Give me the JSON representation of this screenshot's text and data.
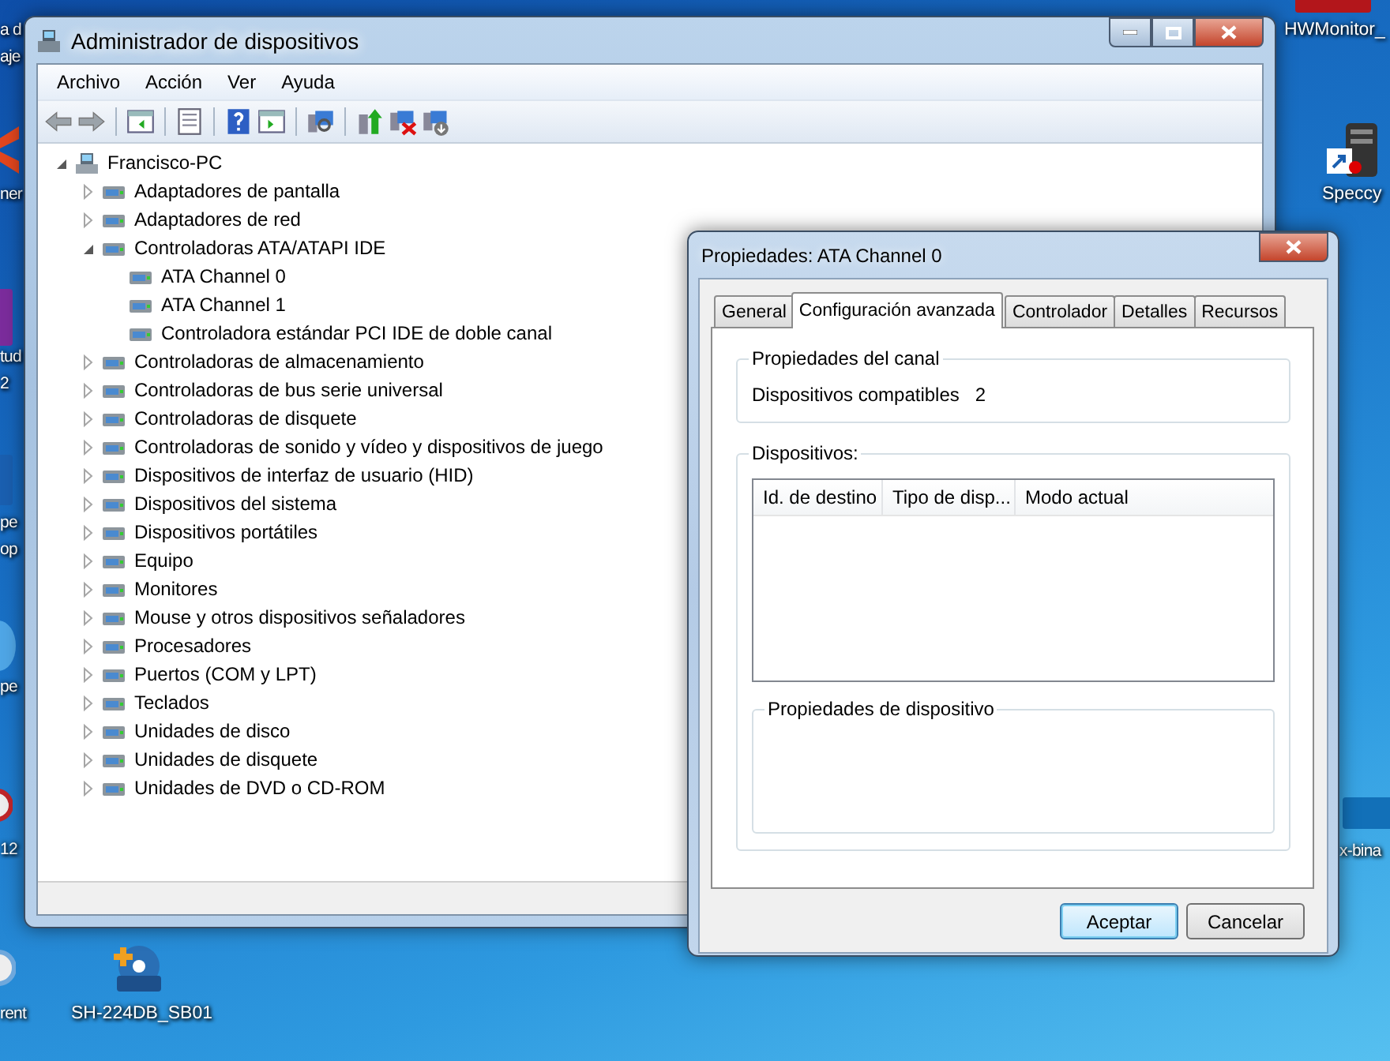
{
  "desktop_icons": [
    {
      "label_lines": [
        "a d",
        "aje"
      ]
    },
    {
      "label_lines": [
        "ner"
      ]
    },
    {
      "label_lines": [
        "tud",
        "2"
      ]
    },
    {
      "label_lines": [
        "pe",
        "op"
      ]
    },
    {
      "label_lines": [
        "pe"
      ]
    },
    {
      "label_lines": [
        "12"
      ]
    },
    {
      "label_lines": [
        "rent"
      ]
    },
    {
      "label_lines": [
        "SH-224DB_SB01"
      ]
    },
    {
      "label_lines": [
        "HWMonitor_"
      ]
    },
    {
      "label_lines": [
        "Speccy"
      ]
    },
    {
      "label_lines": [
        "x-bina"
      ]
    }
  ],
  "device_manager": {
    "title": "Administrador de dispositivos",
    "menu": [
      "Archivo",
      "Acción",
      "Ver",
      "Ayuda"
    ],
    "tree": {
      "label": "Francisco-PC",
      "expanded": true,
      "children": [
        {
          "label": "Adaptadores de pantalla",
          "expanded": false
        },
        {
          "label": "Adaptadores de red",
          "expanded": false
        },
        {
          "label": "Controladoras ATA/ATAPI IDE",
          "expanded": true,
          "children": [
            {
              "label": "ATA Channel 0"
            },
            {
              "label": "ATA Channel 1"
            },
            {
              "label": "Controladora estándar PCI IDE de doble canal"
            }
          ]
        },
        {
          "label": "Controladoras de almacenamiento",
          "expanded": false
        },
        {
          "label": "Controladoras de bus serie universal",
          "expanded": false
        },
        {
          "label": "Controladoras de disquete",
          "expanded": false
        },
        {
          "label": "Controladoras de sonido y vídeo y dispositivos de juego",
          "expanded": false
        },
        {
          "label": "Dispositivos de interfaz de usuario (HID)",
          "expanded": false
        },
        {
          "label": "Dispositivos del sistema",
          "expanded": false
        },
        {
          "label": "Dispositivos portátiles",
          "expanded": false
        },
        {
          "label": "Equipo",
          "expanded": false
        },
        {
          "label": "Monitores",
          "expanded": false
        },
        {
          "label": "Mouse y otros dispositivos señaladores",
          "expanded": false
        },
        {
          "label": "Procesadores",
          "expanded": false
        },
        {
          "label": "Puertos (COM y LPT)",
          "expanded": false
        },
        {
          "label": "Teclados",
          "expanded": false
        },
        {
          "label": "Unidades de disco",
          "expanded": false
        },
        {
          "label": "Unidades de disquete",
          "expanded": false
        },
        {
          "label": "Unidades de DVD o CD-ROM",
          "expanded": false
        }
      ]
    }
  },
  "dialog": {
    "title": "Propiedades: ATA Channel 0",
    "tabs": [
      {
        "label": "General",
        "selected": false
      },
      {
        "label": "Configuración avanzada",
        "selected": true
      },
      {
        "label": "Controlador",
        "selected": false
      },
      {
        "label": "Detalles",
        "selected": false
      },
      {
        "label": "Recursos",
        "selected": false
      }
    ],
    "channel_group": {
      "title": "Propiedades del canal",
      "fields": [
        {
          "label": "Dispositivos compatibles",
          "value": "2"
        }
      ]
    },
    "devices_group": {
      "title": "Dispositivos:",
      "columns": [
        "Id. de destino",
        "Tipo de disp...",
        "Modo actual"
      ],
      "device_properties": {
        "title": "Propiedades de dispositivo"
      }
    },
    "buttons": [
      {
        "label": "Aceptar",
        "default": true
      },
      {
        "label": "Cancelar",
        "default": false
      }
    ]
  }
}
